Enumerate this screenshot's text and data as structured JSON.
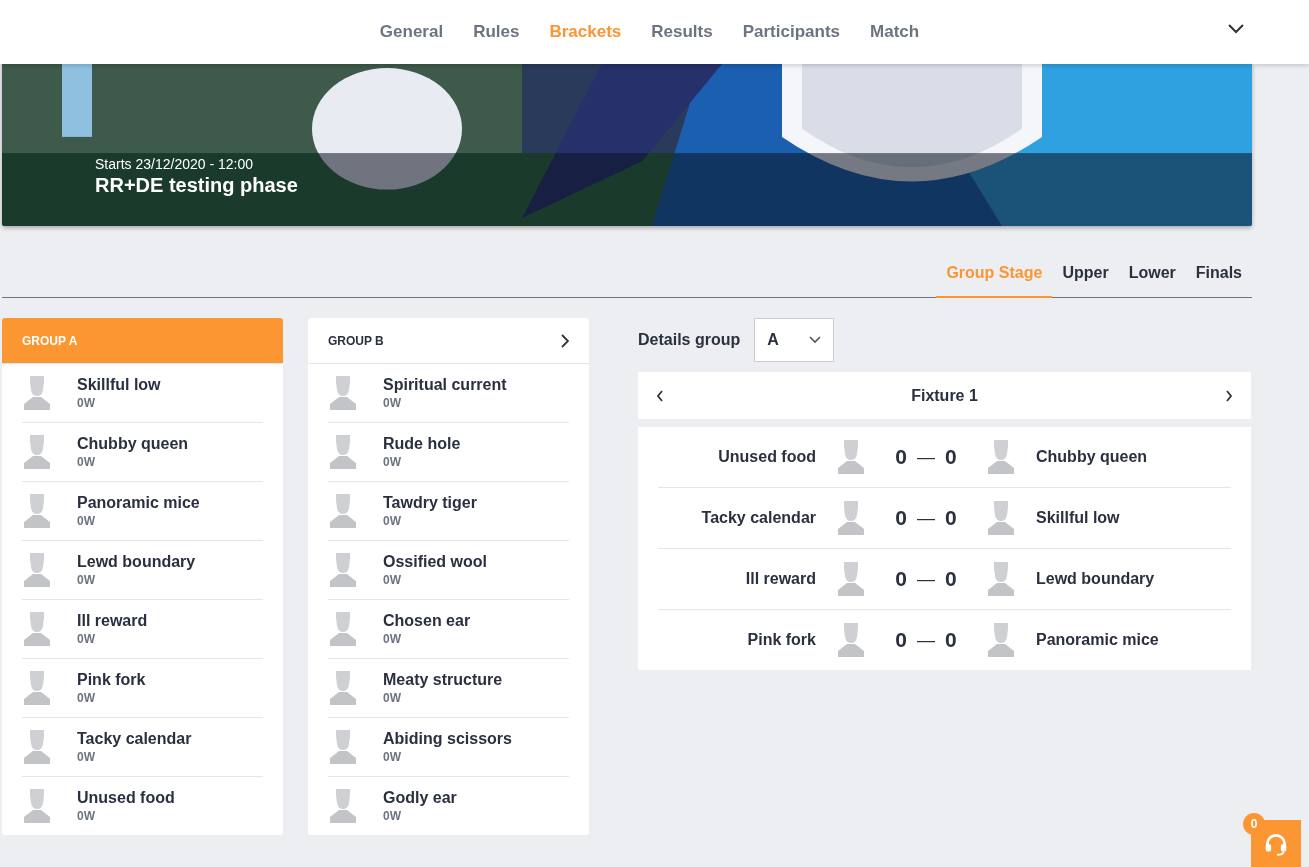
{
  "nav": {
    "items": [
      {
        "label": "General",
        "selected": false
      },
      {
        "label": "Rules",
        "selected": false
      },
      {
        "label": "Brackets",
        "selected": true
      },
      {
        "label": "Results",
        "selected": false
      },
      {
        "label": "Participants",
        "selected": false
      },
      {
        "label": "Match",
        "selected": false
      }
    ]
  },
  "banner": {
    "kind": "picture",
    "starts": "Starts 23/12/2020 - 12:00",
    "title": "RR+DE testing phase"
  },
  "stage_tabs": [
    {
      "label": "Group Stage",
      "selected": true
    },
    {
      "label": "Upper",
      "selected": false
    },
    {
      "label": "Lower",
      "selected": false
    },
    {
      "label": "Finals",
      "selected": false
    }
  ],
  "groups": [
    {
      "title": "GROUP A",
      "selected": true,
      "players": [
        {
          "name": "Skillful low",
          "record": "0W"
        },
        {
          "name": "Chubby queen",
          "record": "0W"
        },
        {
          "name": "Panoramic mice",
          "record": "0W"
        },
        {
          "name": "Lewd boundary",
          "record": "0W"
        },
        {
          "name": "Ill reward",
          "record": "0W"
        },
        {
          "name": "Pink fork",
          "record": "0W"
        },
        {
          "name": "Tacky calendar",
          "record": "0W"
        },
        {
          "name": "Unused food",
          "record": "0W"
        }
      ]
    },
    {
      "title": "GROUP B",
      "selected": false,
      "players": [
        {
          "name": "Spiritual current",
          "record": "0W"
        },
        {
          "name": "Rude hole",
          "record": "0W"
        },
        {
          "name": "Tawdry tiger",
          "record": "0W"
        },
        {
          "name": "Ossified wool",
          "record": "0W"
        },
        {
          "name": "Chosen ear",
          "record": "0W"
        },
        {
          "name": "Meaty structure",
          "record": "0W"
        },
        {
          "name": "Abiding scissors",
          "record": "0W"
        },
        {
          "name": "Godly ear",
          "record": "0W"
        }
      ]
    }
  ],
  "details": {
    "label": "Details group",
    "value": "A"
  },
  "fixture": {
    "title": "Fixture 1"
  },
  "matches": [
    {
      "home": "Unused food",
      "home_score": "0",
      "separator": "—",
      "away_score": "0",
      "away": "Chubby queen"
    },
    {
      "home": "Tacky calendar",
      "home_score": "0",
      "separator": "—",
      "away_score": "0",
      "away": "Skillful low"
    },
    {
      "home": "Ill reward",
      "home_score": "0",
      "separator": "—",
      "away_score": "0",
      "away": "Lewd boundary"
    },
    {
      "home": "Pink fork",
      "home_score": "0",
      "separator": "—",
      "away_score": "0",
      "away": "Panoramic mice"
    }
  ],
  "support": {
    "badge": "0"
  }
}
